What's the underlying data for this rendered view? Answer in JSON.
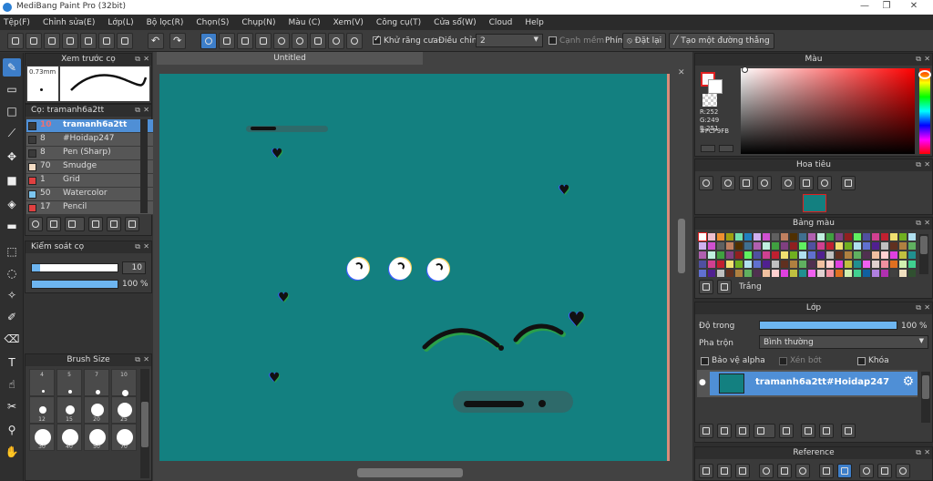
{
  "window": {
    "title": "MediBang Paint Pro (32bit)"
  },
  "menu": [
    "Tệp(F)",
    "Chỉnh sửa(E)",
    "Lớp(L)",
    "Bộ lọc(R)",
    "Chọn(S)",
    "Chụp(N)",
    "Màu (C)",
    "Xem(V)",
    "Công cụ(T)",
    "Cửa sổ(W)",
    "Cloud",
    "Help"
  ],
  "toolbar": {
    "antialias_label": "Khử răng cưa",
    "adjust_label": "Điều chỉnh",
    "adjust_value": "2",
    "edge_label": "Cạnh mềm",
    "pen_label": "Phím",
    "reset_label": "Đặt lại",
    "straight_label": "Tạo một đường thẳng"
  },
  "brush_preview": {
    "title": "Xem trước cọ",
    "size": "0.73mm"
  },
  "brush_panel": {
    "title": "Cọ: tramanh6a2tt",
    "items": [
      {
        "size": "10",
        "name": "tramanh6a2tt",
        "color": "#3a3a3a",
        "selected": true
      },
      {
        "size": "8",
        "name": "#Hoidap247",
        "color": "#3a3a3a",
        "selected": false
      },
      {
        "size": "8",
        "name": "Pen (Sharp)",
        "color": "#3a3a3a",
        "selected": false
      },
      {
        "size": "70",
        "name": "Smudge",
        "color": "#f3dcc4",
        "selected": false
      },
      {
        "size": "1",
        "name": "Grid",
        "color": "#e04040",
        "selected": false
      },
      {
        "size": "50",
        "name": "Watercolor",
        "color": "#7cc6f0",
        "selected": false
      },
      {
        "size": "17",
        "name": "Pencil",
        "color": "#e04040",
        "selected": false
      }
    ]
  },
  "brush_control": {
    "title": "Kiểm soát cọ",
    "size_value": "10",
    "opacity_value": "100 %",
    "size_fill": 0.1,
    "opacity_fill": 1.0
  },
  "brush_size": {
    "title": "Brush Size",
    "labels": [
      "4",
      "5",
      "7",
      "10",
      "12",
      "15",
      "20",
      "25",
      "30",
      "40",
      "50",
      "70"
    ]
  },
  "document": {
    "tab": "Untitled",
    "bg_color": "#138080"
  },
  "color_panel": {
    "title": "Màu",
    "r": "R:252",
    "g": "G:249",
    "b": "B:251",
    "hex": "#FCF9FB"
  },
  "navigator": {
    "title": "Hoa tiêu"
  },
  "palette": {
    "title": "Bảng màu",
    "footer_label": "Trắng"
  },
  "layers": {
    "title": "Lớp",
    "opacity_label": "Độ trong",
    "opacity_value": "100 %",
    "blend_label": "Pha trộn",
    "blend_value": "Bình thường",
    "protect_alpha": "Bảo vệ alpha",
    "clipping": "Xén bớt",
    "lock": "Khóa",
    "layer_name": "tramanh6a2tt#Hoidap247"
  },
  "reference": {
    "title": "Reference"
  }
}
